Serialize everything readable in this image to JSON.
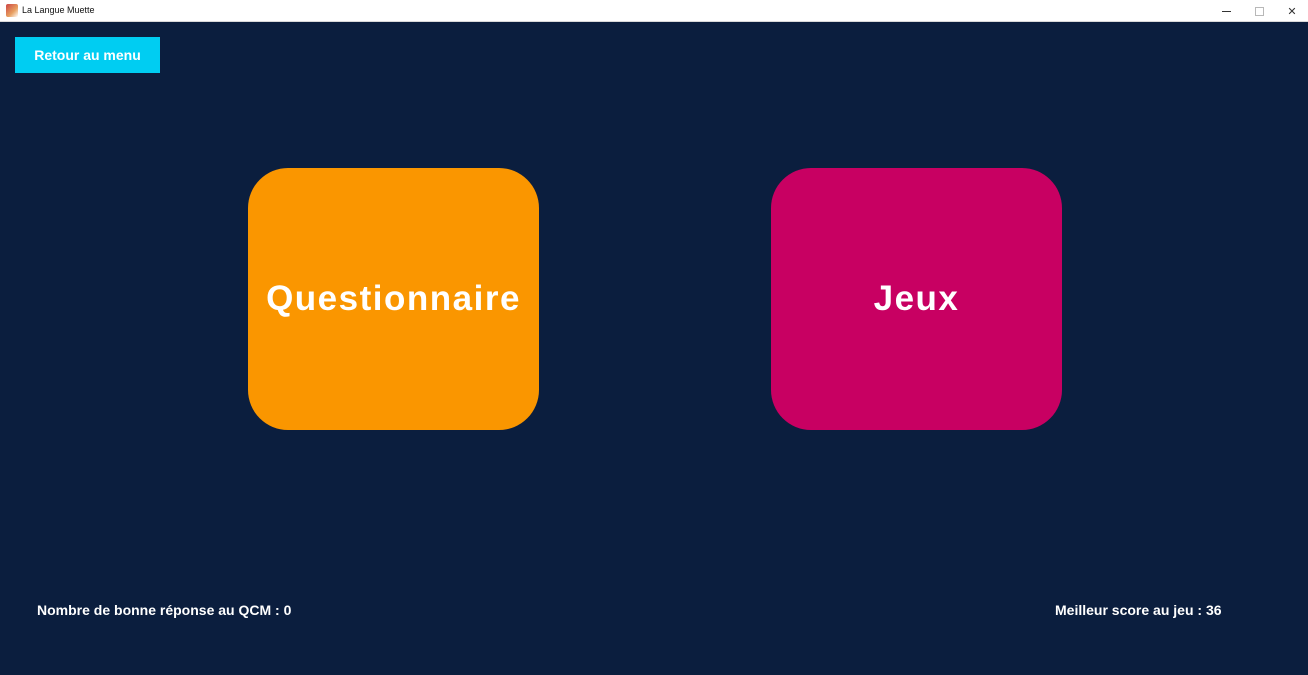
{
  "window": {
    "title": "La Langue Muette",
    "controls": {
      "minimize": "minimize-icon",
      "maximize": "maximize-icon",
      "close": "✕"
    }
  },
  "toolbar": {
    "back_label": "Retour au menu"
  },
  "menu": {
    "questionnaire_label": "Questionnaire",
    "games_label": "Jeux"
  },
  "stats": {
    "qcm_correct_text": "Nombre de bonne réponse au QCM : 0",
    "best_score_text": "Meilleur score au jeu : 36"
  },
  "colors": {
    "background": "#0b1e3e",
    "back_button": "#00cdf2",
    "questionnaire_card": "#fa9600",
    "games_card": "#c80062",
    "text": "#ffffff"
  }
}
